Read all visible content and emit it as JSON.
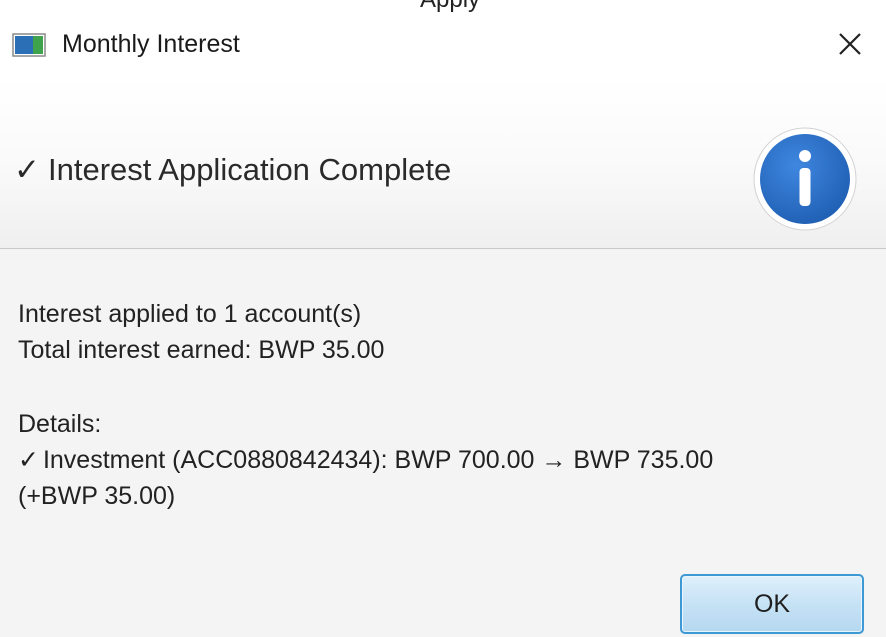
{
  "window": {
    "title": "Monthly Interest",
    "partial_top_text": "Apply"
  },
  "header": {
    "check_symbol": "✓",
    "title": "Interest Application Complete"
  },
  "message": {
    "line1": "Interest applied to 1 account(s)",
    "line2": "Total interest earned: BWP 35.00",
    "details_label": "Details:",
    "detail_check_symbol": "✓",
    "detail_line": "Investment (ACC0880842434): BWP 700.00 → BWP 735.00",
    "detail_line_cont": "(+BWP 35.00)"
  },
  "buttons": {
    "ok_label": "OK"
  },
  "icons": {
    "app": "window-app-icon",
    "close": "close-icon",
    "info": "info-icon",
    "check": "check-icon"
  },
  "colors": {
    "info_blue": "#2f6fc4",
    "button_border": "#3d98d3",
    "button_fill": "#c6e2f5"
  }
}
